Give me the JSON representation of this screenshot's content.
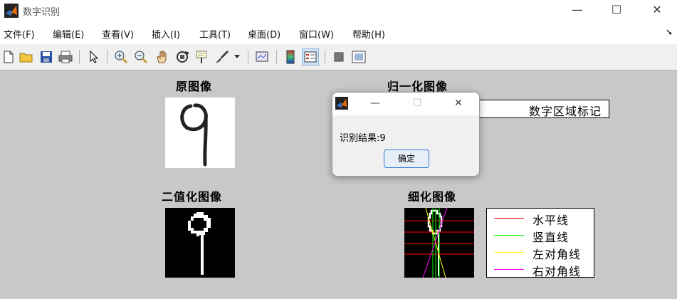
{
  "window": {
    "title": "数字识别",
    "minimize": "—",
    "maximize": "☐",
    "close": "✕"
  },
  "menu": [
    "文件(F)",
    "编辑(E)",
    "查看(V)",
    "插入(I)",
    "工具(T)",
    "桌面(D)",
    "窗口(W)",
    "帮助(H)"
  ],
  "toolbar": {
    "icons": [
      "new-file-icon",
      "open-folder-icon",
      "save-icon",
      "print-icon",
      "pointer-icon",
      "zoom-in-icon",
      "zoom-out-icon",
      "pan-hand-icon",
      "rotate-3d-icon",
      "data-cursor-icon",
      "brush-icon",
      "link-plot-icon",
      "colorbar-icon",
      "legend-icon",
      "hide-plot-tools-icon",
      "show-plot-tools-icon"
    ],
    "active": "legend-icon"
  },
  "panels": {
    "original_title": "原图像",
    "normalized_title": "归一化图像",
    "binary_title": "二值化图像",
    "thinned_title": "细化图像"
  },
  "region_label": "数字区域标记",
  "legend": {
    "items": [
      {
        "label": "水平线",
        "color": "#ff0000"
      },
      {
        "label": "竖直线",
        "color": "#00ff00"
      },
      {
        "label": "左对角线",
        "color": "#ffff00"
      },
      {
        "label": "右对角线",
        "color": "#ff00ff"
      }
    ]
  },
  "dialog": {
    "minimize": "—",
    "maximize": "☐",
    "close": "✕",
    "message": "识别结果:9",
    "ok_label": "确定"
  }
}
